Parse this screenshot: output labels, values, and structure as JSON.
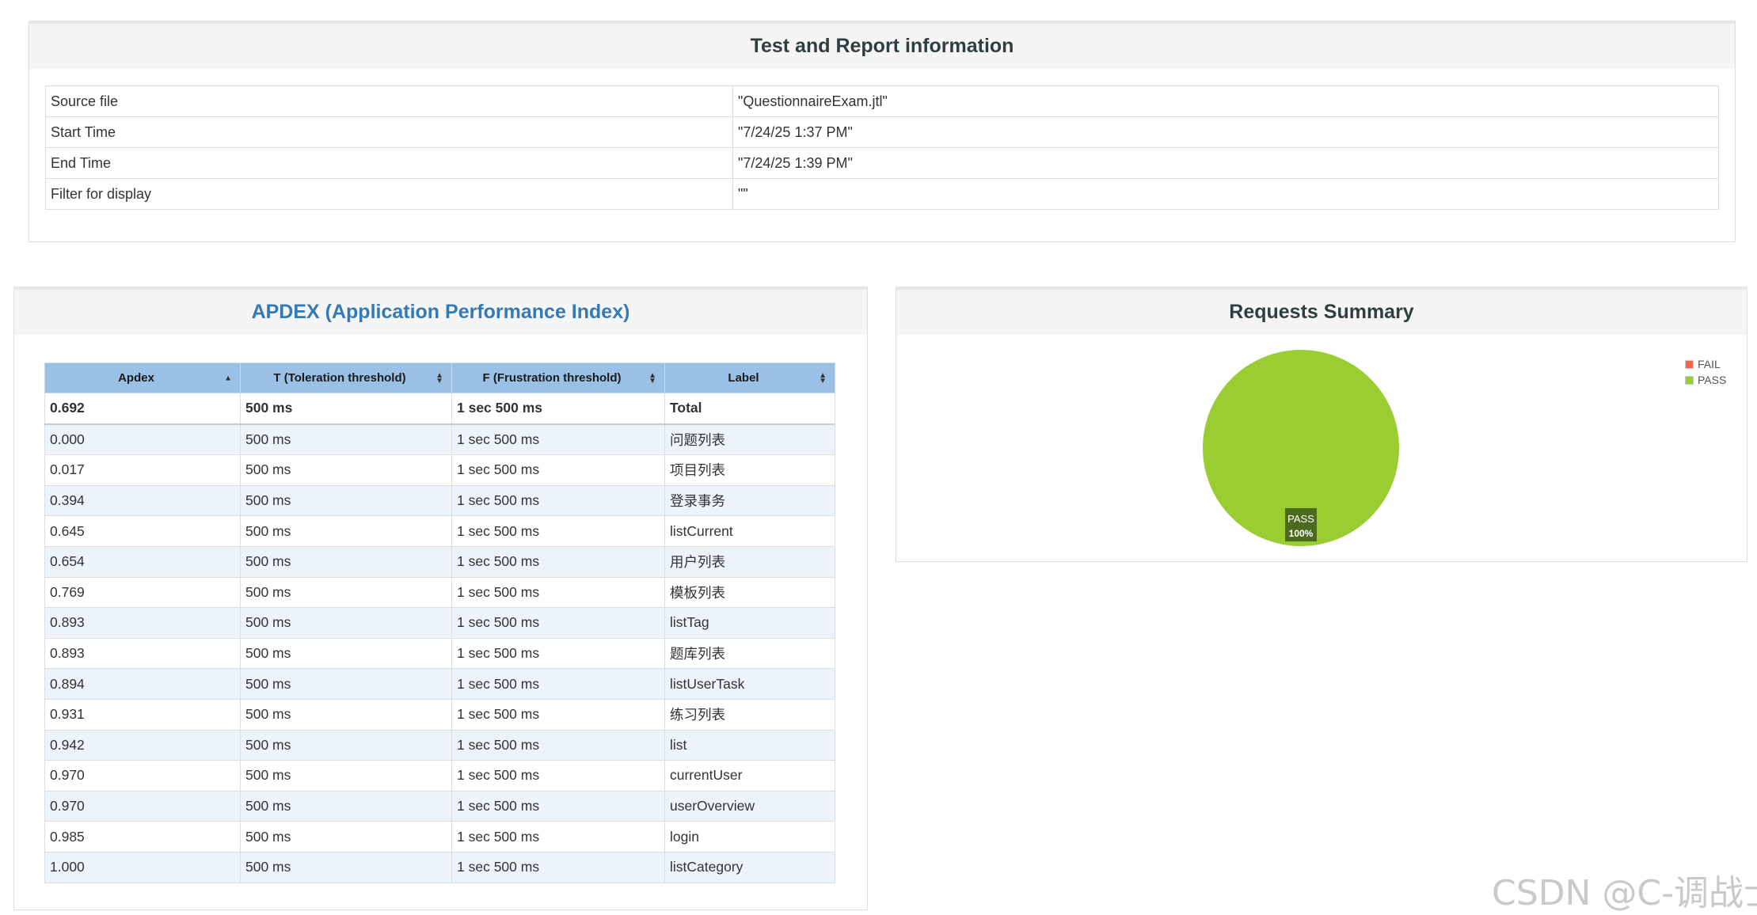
{
  "info": {
    "title": "Test and Report information",
    "rows": [
      {
        "key": "Source file",
        "value": "\"QuestionnaireExam.jtl\""
      },
      {
        "key": "Start Time",
        "value": "\"7/24/25 1:37 PM\""
      },
      {
        "key": "End Time",
        "value": "\"7/24/25 1:39 PM\""
      },
      {
        "key": "Filter for display",
        "value": "\"\""
      }
    ]
  },
  "apdex": {
    "title": "APDEX (Application Performance Index)",
    "headers": [
      "Apdex",
      "T (Toleration threshold)",
      "F (Frustration threshold)",
      "Label"
    ],
    "total": {
      "apdex": "0.692",
      "t": "500 ms",
      "f": "1 sec 500 ms",
      "label": "Total"
    },
    "rows": [
      {
        "apdex": "0.000",
        "t": "500 ms",
        "f": "1 sec 500 ms",
        "label": "问题列表"
      },
      {
        "apdex": "0.017",
        "t": "500 ms",
        "f": "1 sec 500 ms",
        "label": "项目列表"
      },
      {
        "apdex": "0.394",
        "t": "500 ms",
        "f": "1 sec 500 ms",
        "label": "登录事务"
      },
      {
        "apdex": "0.645",
        "t": "500 ms",
        "f": "1 sec 500 ms",
        "label": "listCurrent"
      },
      {
        "apdex": "0.654",
        "t": "500 ms",
        "f": "1 sec 500 ms",
        "label": "用户列表"
      },
      {
        "apdex": "0.769",
        "t": "500 ms",
        "f": "1 sec 500 ms",
        "label": "模板列表"
      },
      {
        "apdex": "0.893",
        "t": "500 ms",
        "f": "1 sec 500 ms",
        "label": "listTag"
      },
      {
        "apdex": "0.893",
        "t": "500 ms",
        "f": "1 sec 500 ms",
        "label": "题库列表"
      },
      {
        "apdex": "0.894",
        "t": "500 ms",
        "f": "1 sec 500 ms",
        "label": "listUserTask"
      },
      {
        "apdex": "0.931",
        "t": "500 ms",
        "f": "1 sec 500 ms",
        "label": "练习列表"
      },
      {
        "apdex": "0.942",
        "t": "500 ms",
        "f": "1 sec 500 ms",
        "label": "list"
      },
      {
        "apdex": "0.970",
        "t": "500 ms",
        "f": "1 sec 500 ms",
        "label": "currentUser"
      },
      {
        "apdex": "0.970",
        "t": "500 ms",
        "f": "1 sec 500 ms",
        "label": "userOverview"
      },
      {
        "apdex": "0.985",
        "t": "500 ms",
        "f": "1 sec 500 ms",
        "label": "login"
      },
      {
        "apdex": "1.000",
        "t": "500 ms",
        "f": "1 sec 500 ms",
        "label": "listCategory"
      }
    ]
  },
  "summary": {
    "title": "Requests Summary",
    "chart_data": {
      "type": "pie",
      "categories": [
        "FAIL",
        "PASS"
      ],
      "values": [
        0,
        100
      ],
      "colors": [
        "#ff6347",
        "#9acd32"
      ],
      "slice_label": {
        "name": "PASS",
        "percent": "100%"
      },
      "legend": "top-right"
    }
  },
  "watermark": "CSDN @C-调战士"
}
